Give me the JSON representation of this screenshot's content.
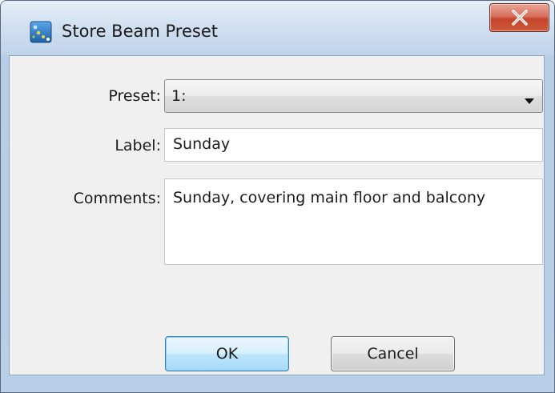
{
  "window": {
    "title": "Store Beam Preset",
    "icon": "app-icon"
  },
  "form": {
    "preset_label": "Preset:",
    "preset_value": "1:",
    "label_label": "Label:",
    "label_value": "Sunday",
    "comments_label": "Comments:",
    "comments_value": "Sunday, covering main floor and balcony"
  },
  "buttons": {
    "ok_label": "OK",
    "cancel_label": "Cancel"
  },
  "colors": {
    "close_button": "#c3442b",
    "ok_button_border": "#3c7fb1",
    "title_bar": "#b9cfe8"
  }
}
